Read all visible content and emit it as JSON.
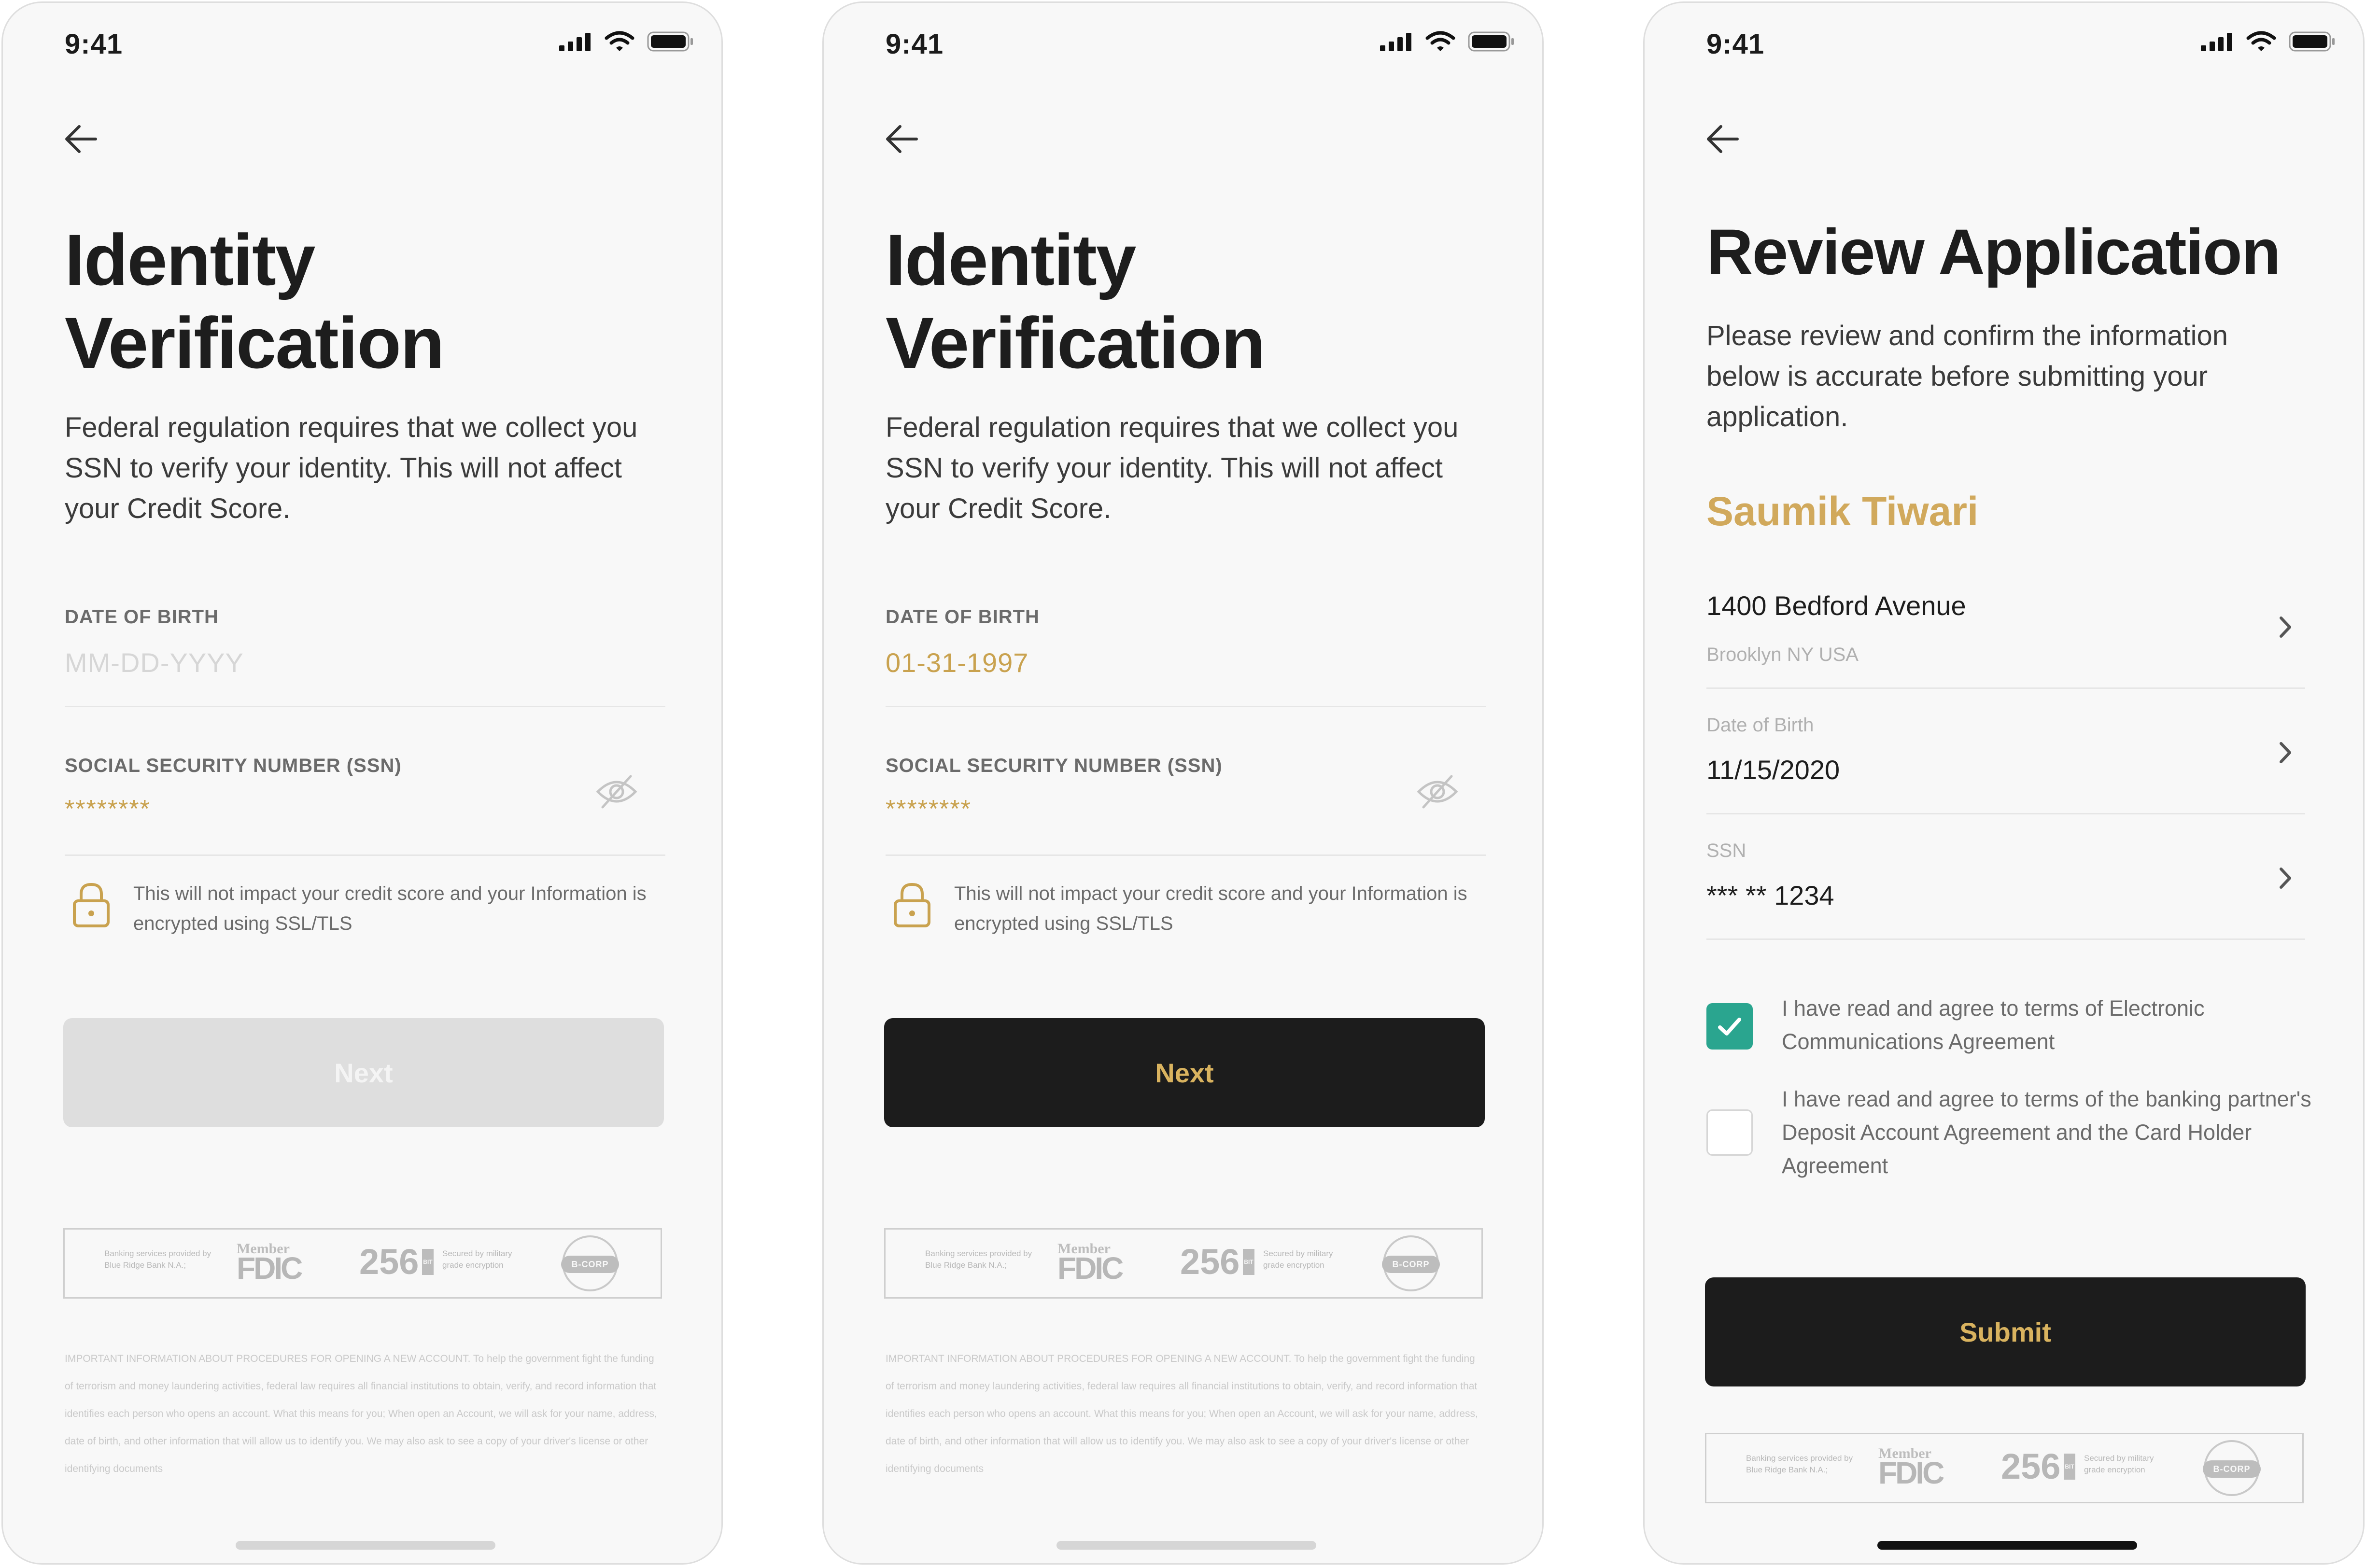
{
  "status_bar": {
    "time": "9:41"
  },
  "colors": {
    "accent_gold": "#c9a24f",
    "button_dark": "#1c1c1c",
    "checkbox_green": "#2aa58f"
  },
  "icons": [
    "signal-icon",
    "wifi-icon",
    "battery-icon",
    "back-arrow-icon",
    "eye-off-icon",
    "lock-icon",
    "chevron-right-icon",
    "check-icon"
  ],
  "identity_empty": {
    "title_line1": "Identity",
    "title_line2": "Verification",
    "description": "Federal regulation requires that we collect you SSN to verify your identity. This will not affect your Credit Score.",
    "dob_label": "DATE OF BIRTH",
    "dob_placeholder": "MM-DD-YYYY",
    "ssn_label": "SOCIAL SECURITY NUMBER (SSN)",
    "ssn_value": "********",
    "notice": "This will not impact your credit score and your Information is encrypted using SSL/TLS",
    "next_label": "Next"
  },
  "identity_filled": {
    "title_line1": "Identity",
    "title_line2": "Verification",
    "description": "Federal regulation requires that we collect you SSN to verify your identity. This will not affect your Credit Score.",
    "dob_label": "DATE OF BIRTH",
    "dob_value": "01-31-1997",
    "ssn_label": "SOCIAL SECURITY NUMBER (SSN)",
    "ssn_value": "********",
    "notice": "This will not impact your credit score and your Information is encrypted using SSL/TLS",
    "next_label": "Next"
  },
  "badge": {
    "bank_line1": "Banking services provided by",
    "bank_line2": "Blue Ridge Bank N.A.;",
    "member": "Member",
    "fdic": "FDIC",
    "bits": "256",
    "bit_label": "BIT",
    "secured_line1": "Secured by military",
    "secured_line2": "grade encryption",
    "bcorp": "B-CORP"
  },
  "legal_text": "IMPORTANT INFORMATION ABOUT PROCEDURES FOR OPENING A NEW ACCOUNT. To help the government fight the funding of terrorism and money laundering activities, federal law requires all financial institutions to obtain, verify, and record information that identifies each person who opens an account. What this means for you; When open an Account, we will ask for your name, address, date of birth, and other information that will allow us to identify you. We may also ask to see a copy of your driver's license or other identifying documents",
  "review": {
    "title": "Review Application",
    "description": "Please review and confirm the information below is accurate before submitting your application.",
    "name": "Saumik Tiwari",
    "address_line1": "1400  Bedford Avenue",
    "address_line2": "Brooklyn NY USA",
    "dob_label": "Date of Birth",
    "dob_value": "11/15/2020",
    "ssn_label": "SSN",
    "ssn_value": "*** ** 1234",
    "agree_electronic": "I have read and agree to terms of Electronic Communications Agreement",
    "agree_electronic_checked": true,
    "agree_deposit": "I have read and agree to terms of the banking partner's Deposit Account Agreement and the Card Holder Agreement",
    "agree_deposit_checked": false,
    "submit_label": "Submit"
  }
}
